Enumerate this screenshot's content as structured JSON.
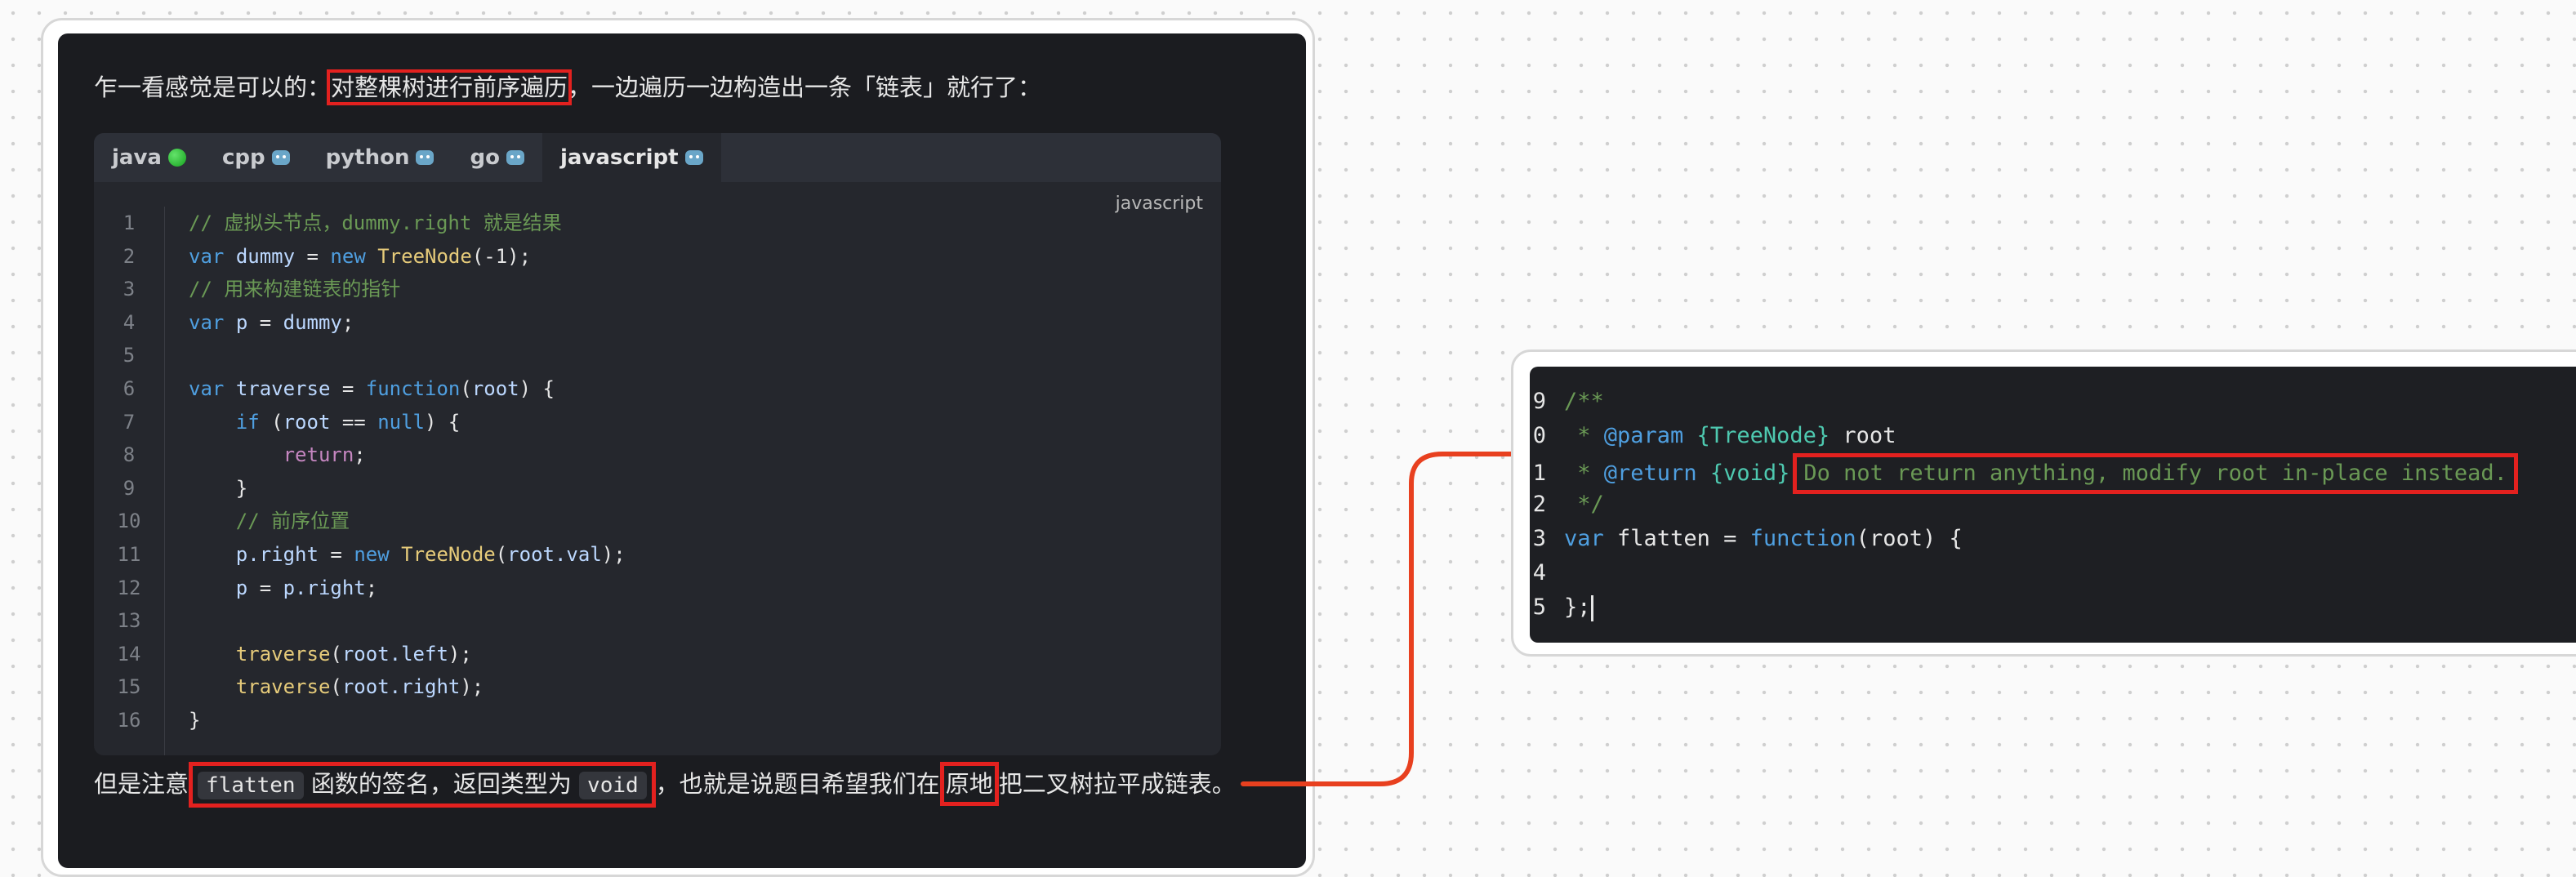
{
  "left_card": {
    "intro": {
      "before": "乍一看感觉是可以的：",
      "highlight": "对整棵树进行前序遍历",
      "after": "，一边遍历一边构造出一条「链表」就行了："
    },
    "tabs": [
      {
        "label": "java",
        "icon": "green-dot-icon"
      },
      {
        "label": "cpp",
        "icon": "robot-icon"
      },
      {
        "label": "python",
        "icon": "robot-icon"
      },
      {
        "label": "go",
        "icon": "robot-icon"
      },
      {
        "label": "javascript",
        "icon": "robot-icon",
        "active": true
      }
    ],
    "code_lang_label": "javascript",
    "line_numbers": [
      "1",
      "2",
      "3",
      "4",
      "5",
      "6",
      "7",
      "8",
      "9",
      "10",
      "11",
      "12",
      "13",
      "14",
      "15",
      "16"
    ],
    "bottom": {
      "p1": "但是注意",
      "code1": "flatten",
      "p2": "函数的签名，返回类型为",
      "code2": "void",
      "p3": "，也就是说题目希望我们在",
      "hl": "原地",
      "p4": "把二叉树拉平成链表。"
    }
  },
  "code": {
    "l1": "// 虚拟头节点，dummy.right 就是结果",
    "l2_kw": "var",
    "l2_var": "dummy",
    "l2_eq": " = ",
    "l2_new": "new",
    "l2_cls": "TreeNode",
    "l2_rest": "(-1);",
    "l3": "// 用来构建链表的指针",
    "l4_kw": "var",
    "l4_var": "p",
    "l4_eq": " = ",
    "l4_val": "dummy",
    "l4_end": ";",
    "l6_kw": "var",
    "l6_name": "traverse",
    "l6_eq": " = ",
    "l6_fn": "function",
    "l6_open": "(",
    "l6_param": "root",
    "l6_close": ") {",
    "l7_if": "if",
    "l7_open": " (",
    "l7_var": "root",
    "l7_op": " == ",
    "l7_null": "null",
    "l7_close": ") {",
    "l8_ret": "return",
    "l8_end": ";",
    "l9": "}",
    "l10": "// 前序位置",
    "l11_lhs": "p.right",
    "l11_eq": " = ",
    "l11_new": "new",
    "l11_cls": "TreeNode",
    "l11_open": "(",
    "l11_arg": "root.val",
    "l11_close": ");",
    "l12_lhs": "p",
    "l12_eq": " = ",
    "l12_rhs": "p.right",
    "l12_end": ";",
    "l14_fn": "traverse",
    "l14_open": "(",
    "l14_arg": "root.left",
    "l14_close": ");",
    "l15_fn": "traverse",
    "l15_open": "(",
    "l15_arg": "root.right",
    "l15_close": ");",
    "l16": "}"
  },
  "right_card": {
    "top_fragment": "*",
    "lines": {
      "n9": "9",
      "n10": "0",
      "n11": "1",
      "n12": "2",
      "n13": "3",
      "n14": "4",
      "n15": "5"
    },
    "l9": "/**",
    "l10_star": " * ",
    "l10_tag": "@param",
    "l10_type": "{TreeNode}",
    "l10_name": "root",
    "l11_star": " * ",
    "l11_tag": "@return",
    "l11_type": "{void}",
    "l11_desc": "Do not return anything, modify root in-place instead.",
    "l12": " */",
    "l13_kw": "var",
    "l13_name": "flatten",
    "l13_eq": " = ",
    "l13_fn": "function",
    "l13_open": "(",
    "l13_param": "root",
    "l13_close": ") {",
    "l15": "};"
  },
  "colors": {
    "annotation_red": "#e3211f",
    "arrow": "#e8401f"
  }
}
